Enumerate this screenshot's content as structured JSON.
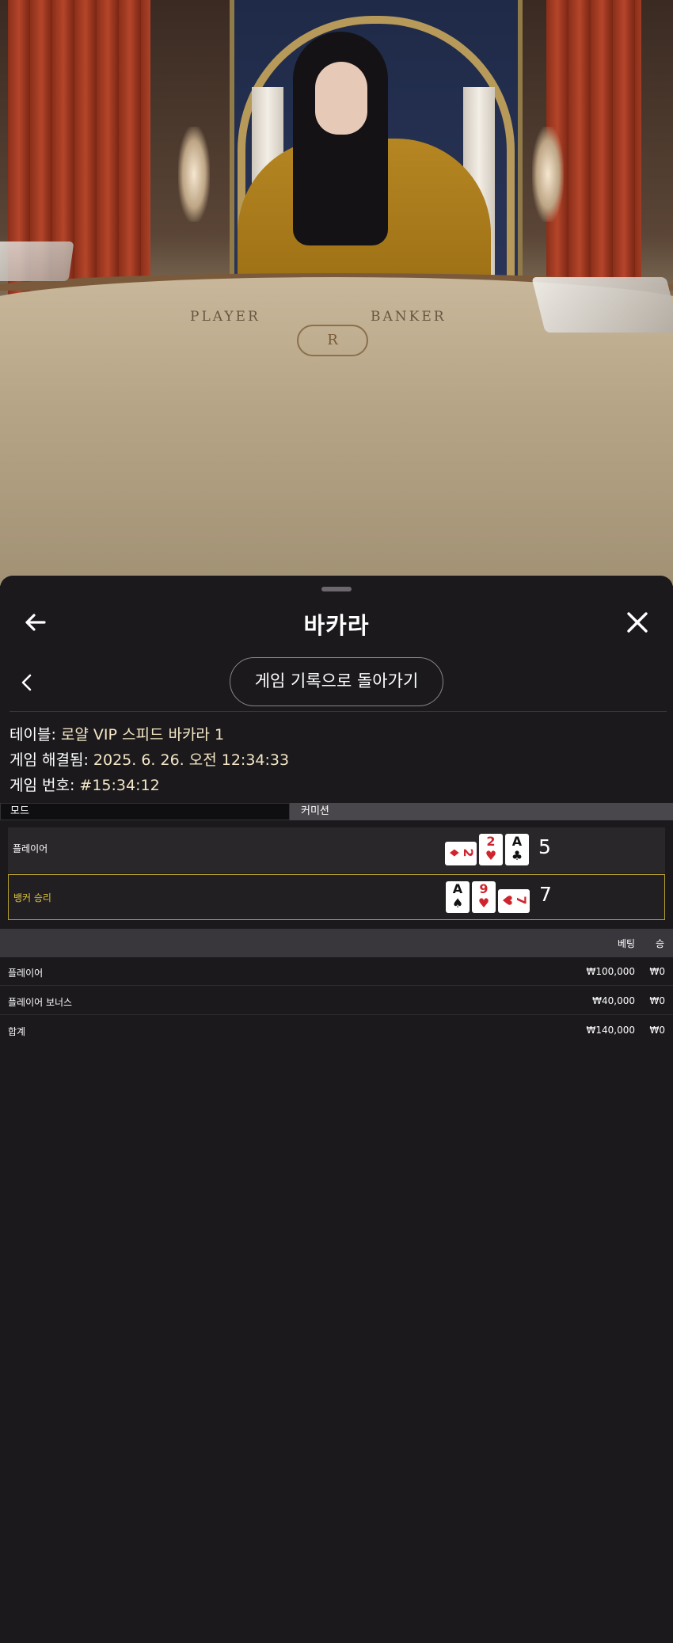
{
  "video": {
    "felt_player": "PLAYER",
    "felt_banker": "BANKER",
    "crest_letter": "R"
  },
  "header": {
    "title": "바카라",
    "back_icon": "arrow-left-icon",
    "close_icon": "close-icon"
  },
  "nav": {
    "back_to_history": "게임 기록으로 돌아가기",
    "chevron_icon": "chevron-left-icon"
  },
  "info": {
    "table_label": "테이블: ",
    "table_value": "로얄 VIP 스피드 바카라 1",
    "resolved_label": "게임 해결됨: ",
    "resolved_value": "2025. 6. 26. 오전 12:34:33",
    "game_no_label": "게임 번호: ",
    "game_no_value": "#15:34:12"
  },
  "mode": {
    "label": "모드",
    "value": "커미션"
  },
  "hands": {
    "player": {
      "label": "플레이어",
      "score": "5",
      "cards": [
        {
          "rank": "2",
          "suit": "♦",
          "color": "red",
          "sideways": true
        },
        {
          "rank": "2",
          "suit": "♥",
          "color": "red",
          "sideways": false
        },
        {
          "rank": "A",
          "suit": "♣",
          "color": "black",
          "sideways": false
        }
      ]
    },
    "banker": {
      "label": "뱅커 승리",
      "score": "7",
      "cards": [
        {
          "rank": "A",
          "suit": "♠",
          "color": "black",
          "sideways": false
        },
        {
          "rank": "9",
          "suit": "♥",
          "color": "red",
          "sideways": false
        },
        {
          "rank": "7",
          "suit": "♥",
          "color": "red",
          "sideways": true
        }
      ]
    }
  },
  "bets": {
    "col_bet": "베팅",
    "col_win": "승",
    "rows": [
      {
        "name": "플레이어",
        "bet": "₩100,000",
        "win": "₩0"
      },
      {
        "name": "플레이어 보너스",
        "bet": "₩40,000",
        "win": "₩0"
      },
      {
        "name": "합계",
        "bet": "₩140,000",
        "win": "₩0"
      }
    ]
  },
  "colors": {
    "sheet_bg": "#1b191c",
    "winner_accent": "#e0c23a",
    "info_value": "#f5e7c6"
  }
}
